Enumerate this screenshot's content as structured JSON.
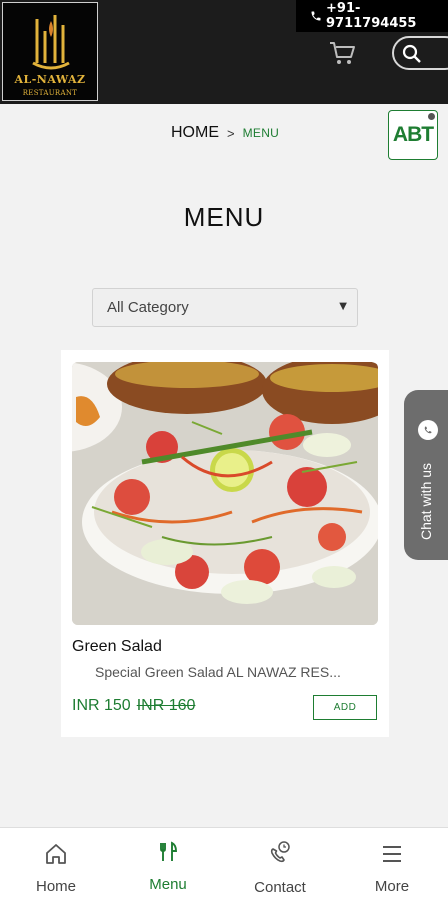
{
  "header": {
    "logo_name": "AL-NAWAZ",
    "logo_sub": "RESTAURANT",
    "phone": "+91-9711794455",
    "icons": {
      "phone": "phone-icon",
      "cart": "cart-icon",
      "search": "search-icon"
    }
  },
  "breadcrumb": {
    "home": "HOME",
    "separator": ">",
    "current": "MENU"
  },
  "badge": {
    "label": "ABT"
  },
  "page": {
    "title": "MENU"
  },
  "category": {
    "selected": "All Category",
    "options": [
      "All Category"
    ]
  },
  "items": [
    {
      "name": "Green Salad",
      "description": "Special Green Salad AL NAWAZ RES...",
      "price": "INR 150",
      "old_price": "INR 160",
      "add_label": "ADD"
    }
  ],
  "chat": {
    "label": "Chat with us",
    "icon": "whatsapp-icon"
  },
  "bottom_nav": [
    {
      "label": "Home",
      "icon": "home-icon",
      "active": false
    },
    {
      "label": "Menu",
      "icon": "fork-knife-icon",
      "active": true
    },
    {
      "label": "Contact",
      "icon": "phone-call-icon",
      "active": false
    },
    {
      "label": "More",
      "icon": "hamburger-icon",
      "active": false
    }
  ],
  "colors": {
    "accent": "#1e7d32",
    "header_bg": "#1c1c1c",
    "logo_gold": "#e2b33b"
  }
}
